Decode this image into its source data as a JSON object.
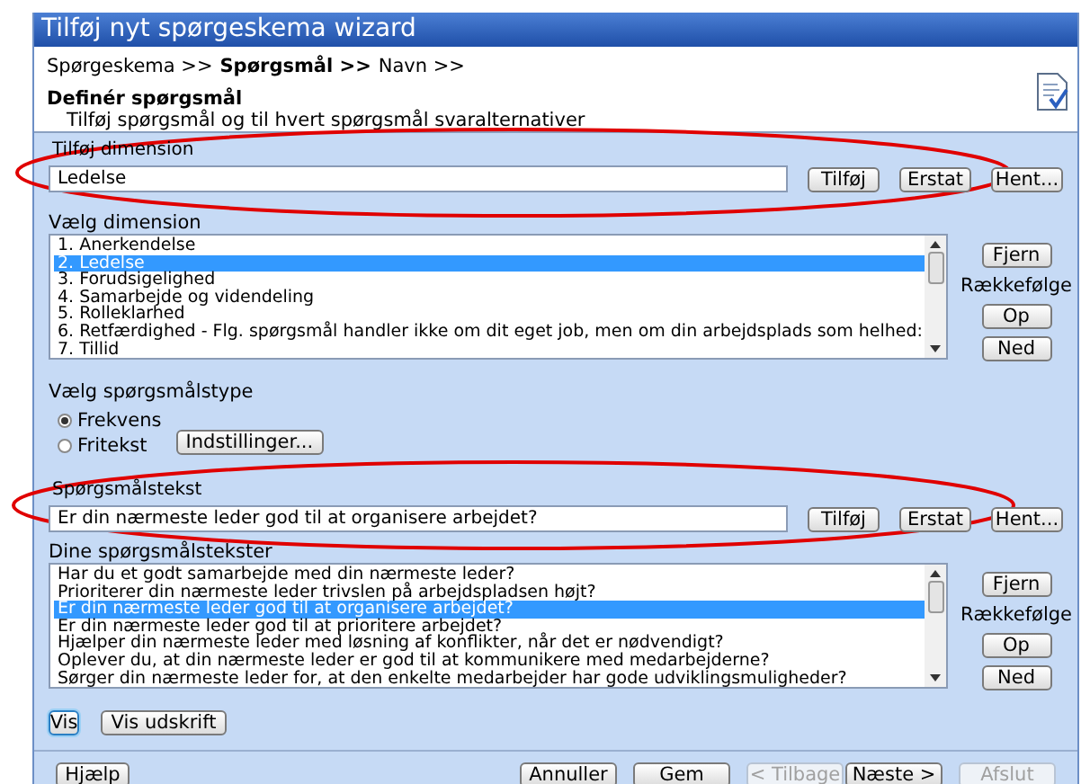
{
  "window": {
    "title": "Tilføj nyt spørgeskema wizard"
  },
  "breadcrumb": [
    {
      "label": "Spørgeskema >>",
      "selected": false
    },
    {
      "label": "Spørgsmål >>",
      "selected": true
    },
    {
      "label": "Navn >>",
      "selected": false
    }
  ],
  "header": {
    "title": "Definér spørgsmål",
    "subtitle": "Tilføj spørgsmål og til hvert spørgsmål svaralternativer"
  },
  "dimension_field": {
    "label": "Tilføj dimension",
    "value": "Ledelse",
    "buttons": [
      "Tilføj",
      "Erstat",
      "Hent..."
    ]
  },
  "dimension_list": {
    "label": "Vælg dimension",
    "items": [
      {
        "label": "1. Anerkendelse",
        "selected": false
      },
      {
        "label": "2. Ledelse",
        "selected": true
      },
      {
        "label": "3. Forudsigelighed",
        "selected": false
      },
      {
        "label": "4. Samarbejde og videndeling",
        "selected": false
      },
      {
        "label": "5. Rolleklarhed",
        "selected": false
      },
      {
        "label": "6. Retfærdighed - Flg. spørgsmål handler ikke om dit eget job, men om din arbejdsplads som helhed:",
        "selected": false
      },
      {
        "label": "7. Tillid",
        "selected": false
      }
    ],
    "remove_button": "Fjern",
    "order_label": "Rækkefølge",
    "up_button": "Op",
    "down_button": "Ned"
  },
  "question_type": {
    "label": "Vælg spørgsmålstype",
    "options": [
      {
        "label": "Frekvens",
        "selected": true
      },
      {
        "label": "Fritekst",
        "selected": false
      }
    ],
    "settings_button": "Indstillinger..."
  },
  "question_field": {
    "label": "Spørgsmålstekst",
    "value": "Er din nærmeste leder god til at organisere arbejdet?",
    "buttons": [
      "Tilføj",
      "Erstat",
      "Hent..."
    ]
  },
  "question_list": {
    "label": "Dine spørgsmålstekster",
    "items": [
      {
        "label": "Har du et godt samarbejde med din nærmeste leder?",
        "selected": false
      },
      {
        "label": "Prioriterer din nærmeste leder trivslen på arbejdspladsen højt?",
        "selected": false
      },
      {
        "label": "Er din nærmeste leder god til at organisere arbejdet?",
        "selected": true
      },
      {
        "label": "Er din nærmeste leder god til at prioritere arbejdet?",
        "selected": false
      },
      {
        "label": "Hjælper din nærmeste leder med løsning af konflikter, når det er nødvendigt?",
        "selected": false
      },
      {
        "label": "Oplever du, at din nærmeste leder er god til at kommunikere med medarbejderne?",
        "selected": false
      },
      {
        "label": "Sørger din nærmeste leder for, at den enkelte medarbejder har gode udviklingsmuligheder?",
        "selected": false
      }
    ],
    "remove_button": "Fjern",
    "order_label": "Rækkefølge",
    "up_button": "Op",
    "down_button": "Ned"
  },
  "view_buttons": [
    {
      "label": "Vis",
      "focused": true
    },
    {
      "label": "Vis udskrift",
      "focused": false
    }
  ],
  "footer_buttons": [
    {
      "label": "Hjælp",
      "disabled": false
    },
    {
      "label": "Annuller",
      "disabled": false
    },
    {
      "label": "Gem",
      "disabled": false
    },
    {
      "label": "< Tilbage",
      "disabled": true
    },
    {
      "label": "Næste >",
      "disabled": false
    },
    {
      "label": "Afslut",
      "disabled": true
    }
  ]
}
